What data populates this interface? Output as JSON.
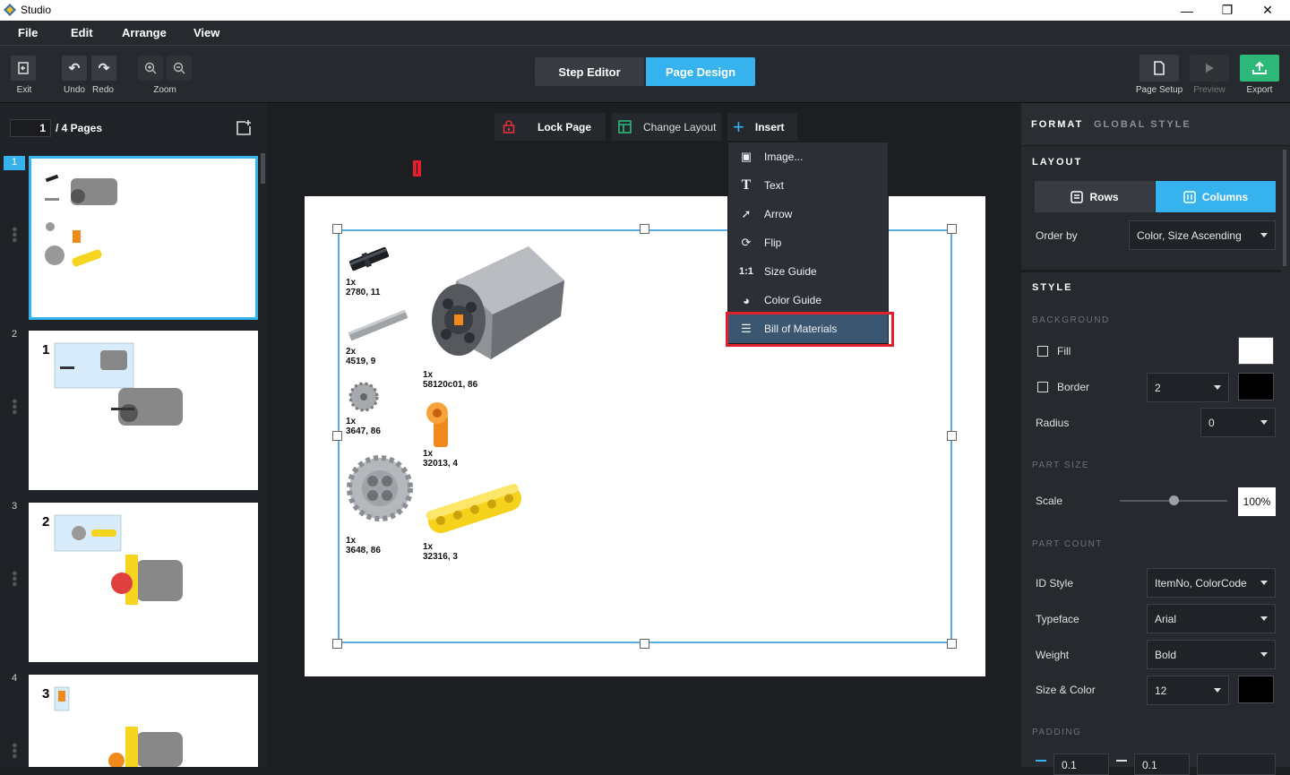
{
  "app": {
    "title": "Studio"
  },
  "menu": [
    "File",
    "Edit",
    "Arrange",
    "View"
  ],
  "toolbar": {
    "exit_label": "Exit",
    "undo_label": "Undo",
    "redo_label": "Redo",
    "zoom_label": "Zoom",
    "step_editor": "Step Editor",
    "page_design": "Page Design",
    "page_setup": "Page Setup",
    "preview": "Preview",
    "export": "Export"
  },
  "pages": {
    "current": "1",
    "total_label": "/ 4 Pages",
    "thumbnails": [
      {
        "num": "1",
        "step": ""
      },
      {
        "num": "2",
        "step": "1"
      },
      {
        "num": "3",
        "step": "2"
      },
      {
        "num": "4",
        "step": "3"
      }
    ]
  },
  "canvas_tools": {
    "lock_page": "Lock Page",
    "change_layout": "Change Layout",
    "insert": "Insert"
  },
  "insert_menu": [
    {
      "icon": "image-icon",
      "glyph": "▣",
      "label": "Image..."
    },
    {
      "icon": "text-icon",
      "glyph": "T",
      "label": "Text"
    },
    {
      "icon": "arrow-icon",
      "glyph": "➚",
      "label": "Arrow"
    },
    {
      "icon": "flip-icon",
      "glyph": "⟳",
      "label": "Flip"
    },
    {
      "icon": "size-guide-icon",
      "glyph": "1:1",
      "label": "Size Guide"
    },
    {
      "icon": "color-guide-icon",
      "glyph": "◕",
      "label": "Color Guide"
    },
    {
      "icon": "list-icon",
      "glyph": "☰",
      "label": "Bill of Materials"
    }
  ],
  "bom_parts": [
    {
      "qty": "1x",
      "id": "2780, 11"
    },
    {
      "qty": "2x",
      "id": "4519, 9"
    },
    {
      "qty": "1x",
      "id": "3647, 86"
    },
    {
      "qty": "1x",
      "id": "3648, 86"
    },
    {
      "qty": "1x",
      "id": "58120c01, 86"
    },
    {
      "qty": "1x",
      "id": "32013, 4"
    },
    {
      "qty": "1x",
      "id": "32316, 3"
    }
  ],
  "right_panel": {
    "tabs": [
      "FORMAT",
      "GLOBAL STYLE"
    ],
    "layout_title": "LAYOUT",
    "rows": "Rows",
    "columns": "Columns",
    "order_by_label": "Order by",
    "order_by_value": "Color, Size Ascending",
    "style_title": "STYLE",
    "background_title": "BACKGROUND",
    "fill_label": "Fill",
    "border_label": "Border",
    "border_value": "2",
    "radius_label": "Radius",
    "radius_value": "0",
    "part_size_title": "PART SIZE",
    "scale_label": "Scale",
    "scale_value": "100%",
    "part_count_title": "PART COUNT",
    "id_style_label": "ID Style",
    "id_style_value": "ItemNo, ColorCode",
    "typeface_label": "Typeface",
    "typeface_value": "Arial",
    "weight_label": "Weight",
    "weight_value": "Bold",
    "size_color_label": "Size & Color",
    "size_color_value": "12",
    "padding_title": "PADDING",
    "padding_values": [
      "0.1",
      "0.1"
    ]
  },
  "colors": {
    "accent": "#36b3ee",
    "highlight_red": "#e0202a",
    "dropdown_selected": "#3a5670",
    "export_green": "#2db87a"
  }
}
